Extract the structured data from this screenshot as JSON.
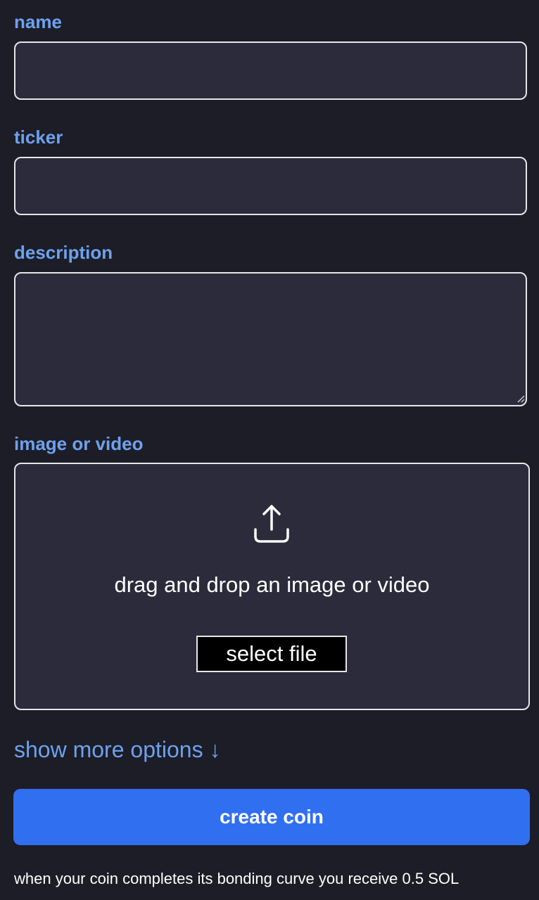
{
  "form": {
    "name_label": "name",
    "name_value": "",
    "ticker_label": "ticker",
    "ticker_value": "",
    "description_label": "description",
    "description_value": "",
    "media_label": "image or video",
    "drop_text": "drag and drop an image or video",
    "select_file_label": "select file",
    "more_options_label": "show more options ↓",
    "create_label": "create coin",
    "footnote": "when your coin completes its bonding curve you receive 0.5 SOL"
  },
  "icons": {
    "upload": "upload-icon",
    "resize": "resize-grip-icon"
  },
  "colors": {
    "background": "#1c1d27",
    "field_background": "#2b2b3c",
    "label": "#6ea1ed",
    "border": "#e6e6ea",
    "primary_button": "#316ff1"
  }
}
